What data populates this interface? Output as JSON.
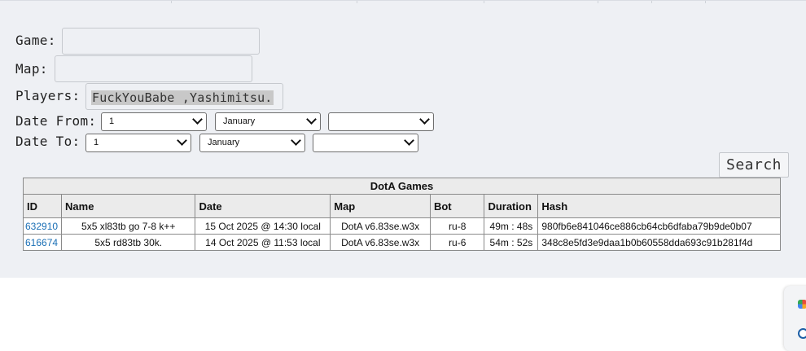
{
  "form": {
    "game_label": "Game:",
    "game_value": "",
    "map_label": "Map:",
    "map_value": "",
    "players_label": "Players:",
    "players_value": "FuckYouBabe ,Yashimitsu.",
    "date_from_label": "Date From:",
    "date_from": {
      "day": "1",
      "month": "January",
      "year": ""
    },
    "date_to_label": "Date To:",
    "date_to": {
      "day": "1",
      "month": "January",
      "year": ""
    },
    "search_label": "Search"
  },
  "table": {
    "caption": "DotA Games",
    "columns": [
      "ID",
      "Name",
      "Date",
      "Map",
      "Bot",
      "Duration",
      "Hash"
    ],
    "rows": [
      {
        "id": "632910",
        "name": "5x5 xl83tb go 7-8 k++",
        "date": "15 Oct 2025 @ 14:30 local",
        "map": "DotA v6.83se.w3x",
        "bot": "ru-8",
        "duration": "49m : 48s",
        "hash": "980fb6e841046ce886cb64cb6dfaba79b9de0b07"
      },
      {
        "id": "616674",
        "name": "5x5 rd83tb 30k.",
        "date": "14 Oct 2025 @ 11:53 local",
        "map": "DotA v6.83se.w3x",
        "bot": "ru-6",
        "duration": "54m : 52s",
        "hash": "348c8e5fd3e9daa1b0b60558dda693c91b281f4d"
      }
    ]
  },
  "colors": {
    "panel_bg": "#eef0f4",
    "link": "#1a6fb5",
    "header_bg": "#ebebeb"
  }
}
